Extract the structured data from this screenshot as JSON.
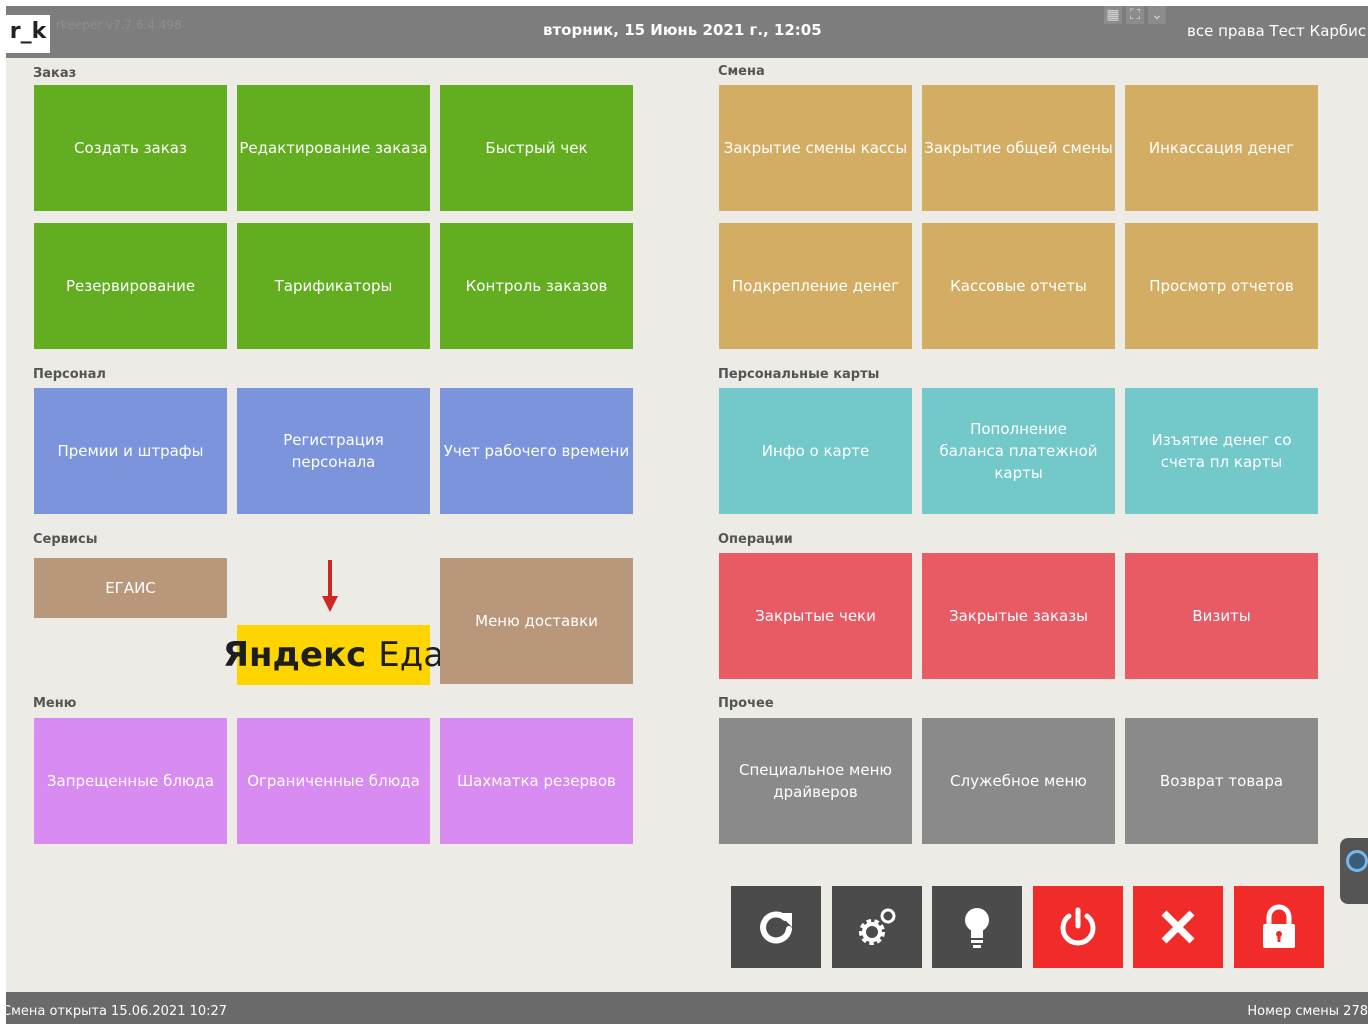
{
  "header": {
    "logo": "r_k",
    "version": "rkeeper v7.7.6.4.498",
    "datetime": "вторник, 15 Июнь 2021 г., 12:05",
    "rights": "все права Тест Карбис"
  },
  "sections": {
    "order": "Заказ",
    "shift": "Смена",
    "staff": "Персонал",
    "cards": "Персональные карты",
    "services": "Сервисы",
    "operations": "Операции",
    "menu": "Меню",
    "other": "Прочее"
  },
  "tiles": {
    "create_order": "Создать заказ",
    "edit_order": "Редактирование заказа",
    "quick_check": "Быстрый чек",
    "reservation": "Резервирование",
    "tariffs": "Тарификаторы",
    "order_control": "Контроль заказов",
    "close_cash_shift": "Закрытие смены кассы",
    "close_common_shift": "Закрытие общей смены",
    "cash_collection": "Инкассация денег",
    "money_reinforcement": "Подкрепление денег",
    "cash_reports": "Кассовые отчеты",
    "view_reports": "Просмотр отчетов",
    "bonuses_fines": "Премии и штрафы",
    "staff_registration": "Регистрация персонала",
    "work_time": "Учет рабочего времени",
    "card_info": "Инфо о карте",
    "card_topup": "Пополнение баланса платежной карты",
    "card_withdraw": "Изъятие денег со счета пл карты",
    "egais": "ЕГАИС",
    "delivery_menu": "Меню доставки",
    "closed_checks": "Закрытые чеки",
    "closed_orders": "Закрытые заказы",
    "visits": "Визиты",
    "forbidden_dishes": "Запрещенные блюда",
    "limited_dishes": "Ограниченные блюда",
    "reserve_chess": "Шахматка резервов",
    "driver_menu": "Специальное меню драйверов",
    "service_menu": "Служебное меню",
    "return_goods": "Возврат товара"
  },
  "yandex": {
    "brand": "Яндекс",
    "product": "Еда"
  },
  "actions": [
    {
      "name": "refresh",
      "icon": "refresh-icon"
    },
    {
      "name": "settings",
      "icon": "gears-icon"
    },
    {
      "name": "hint",
      "icon": "lightbulb-icon"
    },
    {
      "name": "power",
      "icon": "power-icon"
    },
    {
      "name": "close",
      "icon": "close-icon"
    },
    {
      "name": "lock",
      "icon": "lock-icon"
    }
  ],
  "footer": {
    "shift_opened": "Смена открыта 15.06.2021 10:27",
    "shift_number": "Номер смены 278"
  },
  "colors": {
    "order": "#62ad20",
    "shift": "#d4ad64",
    "staff": "#7b94dc",
    "cards": "#73c8c9",
    "services": "#b8977a",
    "operations": "#e85a64",
    "menu": "#d88bf0",
    "other": "#8a8a8a",
    "danger": "#f12a2a"
  }
}
